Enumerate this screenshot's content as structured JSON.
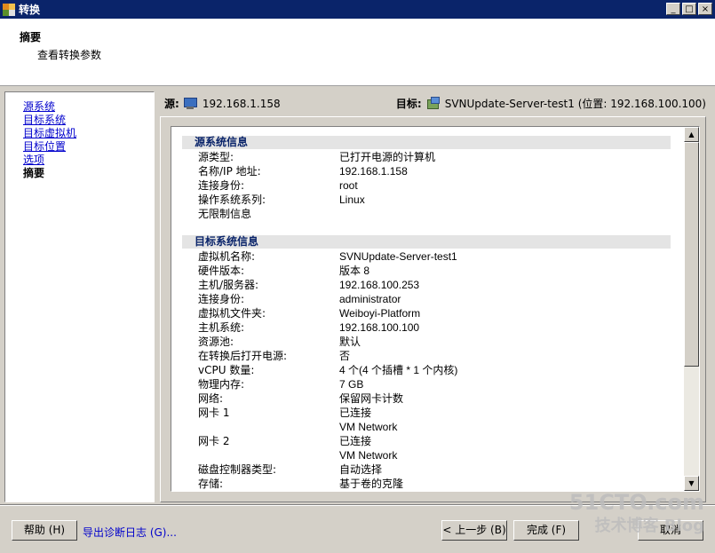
{
  "window": {
    "title": "转换",
    "controls": [
      "_",
      "□",
      "×"
    ]
  },
  "header": {
    "title": "摘要",
    "subtitle": "查看转换参数"
  },
  "nav": {
    "items": [
      {
        "label": "源系统"
      },
      {
        "label": "目标系统"
      },
      {
        "label": "目标虚拟机"
      },
      {
        "label": "目标位置"
      },
      {
        "label": "选项"
      }
    ],
    "current": "摘要"
  },
  "source": {
    "label": "源:",
    "address": "192.168.1.158"
  },
  "target": {
    "label": "目标:",
    "name": "SVNUpdate-Server-test1  (位置: 192.168.100.100)"
  },
  "summary": {
    "source_section": {
      "title": "源系统信息",
      "rows": [
        {
          "k": "源类型:",
          "v": "已打开电源的计算机"
        },
        {
          "k": "名称/IP 地址:",
          "v": "192.168.1.158"
        },
        {
          "k": "连接身份:",
          "v": "root"
        },
        {
          "k": "操作系统系列:",
          "v": "Linux"
        },
        {
          "k": "无限制信息",
          "v": ""
        }
      ]
    },
    "target_section": {
      "title": "目标系统信息",
      "rows": [
        {
          "k": "虚拟机名称:",
          "v": "SVNUpdate-Server-test1"
        },
        {
          "k": "硬件版本:",
          "v": "版本 8"
        },
        {
          "k": "主机/服务器:",
          "v": "192.168.100.253"
        },
        {
          "k": "连接身份:",
          "v": "administrator"
        },
        {
          "k": "虚拟机文件夹:",
          "v": "Weiboyi-Platform"
        },
        {
          "k": "主机系统:",
          "v": "192.168.100.100"
        },
        {
          "k": "资源池:",
          "v": "默认"
        },
        {
          "k": "在转换后打开电源:",
          "v": "否"
        },
        {
          "k": "vCPU 数量:",
          "v": "4 个(4 个插槽 * 1 个内核)"
        },
        {
          "k": "物理内存:",
          "v": "7 GB"
        },
        {
          "k": "网络:",
          "v": "保留网卡计数"
        },
        {
          "k": "网卡 1",
          "v": "已连接"
        },
        {
          "k": "",
          "v": "VM Network"
        },
        {
          "k": "网卡 2",
          "v": "已连接"
        },
        {
          "k": "",
          "v": "VM Network"
        },
        {
          "k": "磁盘控制器类型:",
          "v": "自动选择"
        },
        {
          "k": "存储:",
          "v": "基于卷的克隆"
        }
      ]
    }
  },
  "footer": {
    "help": "帮助 (H)",
    "diag": "导出诊断日志 (G)...",
    "back": "< 上一步 (B)",
    "finish": "完成 (F)",
    "cancel": "取消"
  },
  "watermark": {
    "line1": "51CTO.com",
    "line2": "技术博客 Blog"
  }
}
